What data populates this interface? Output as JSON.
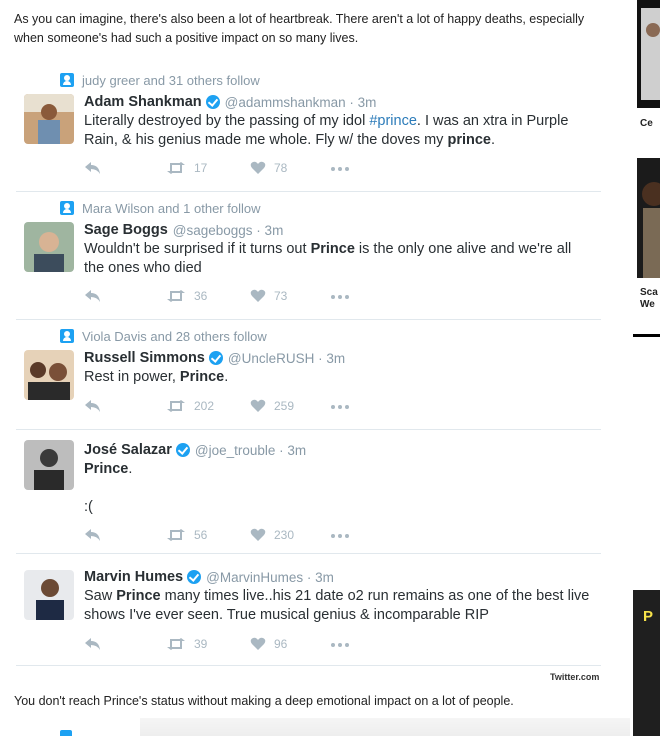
{
  "article": {
    "intro": "As you can imagine, there's also been a lot of heartbreak. There aren't a lot of happy deaths, especially when someone's had such a positive impact on so many lives.",
    "outro": "You don't reach Prince's status without making a deep emotional impact on a lot of people.",
    "source": "Twitter.com"
  },
  "tweets": [
    {
      "social": "judy greer and 31 others follow",
      "name": "Adam Shankman",
      "verified": true,
      "handle": "@adammshankman · 3m",
      "text_a": "Literally destroyed by the passing of my idol ",
      "hashtag": "#prince",
      "text_b": ". I was an xtra in Purple Rain, & his genius made me whole. Fly w/ the doves my ",
      "bold_end": "prince",
      "text_c": ".",
      "retweets": "17",
      "likes": "78"
    },
    {
      "social": "Mara Wilson and 1 other follow",
      "name": "Sage Boggs",
      "verified": false,
      "handle": "@sageboggs · 3m",
      "text_a": "Wouldn't be surprised if it turns out ",
      "bold": "Prince",
      "text_b": " is the only one alive and we're all the ones who died",
      "retweets": "36",
      "likes": "73"
    },
    {
      "social": "Viola Davis and 28 others follow",
      "name": "Russell Simmons",
      "verified": true,
      "handle": "@UncleRUSH · 3m",
      "text_a": "Rest in power, ",
      "bold": "Prince",
      "text_b": ".",
      "retweets": "202",
      "likes": "259"
    },
    {
      "name": "José Salazar",
      "verified": true,
      "handle": "@joe_trouble · 3m",
      "bold": "Prince",
      "text_b": ".",
      "text_line2": ":(",
      "retweets": "56",
      "likes": "230"
    },
    {
      "name": "Marvin Humes",
      "verified": true,
      "handle": "@MarvinHumes · 3m",
      "text_a": "Saw ",
      "bold": "Prince",
      "text_b": " many times live..his 21 date o2 run remains as one of the best live shows I've ever seen. True musical genius & incomparable RIP",
      "retweets": "39",
      "likes": "96"
    }
  ],
  "rail": {
    "caption1": "Ce",
    "caption2a": "Sca",
    "caption2b": "We",
    "promo": "P"
  },
  "icons": {
    "reply": "reply-icon",
    "retweet": "retweet-icon",
    "like": "heart-icon",
    "more": "more-icon",
    "follow_badge": "follow-badge-icon",
    "verified": "verified-icon"
  },
  "colors": {
    "twitter_blue": "#1da1f2",
    "hashtag": "#2b7bb9",
    "muted": "#8899a6",
    "action_gray": "#aab8c2"
  }
}
